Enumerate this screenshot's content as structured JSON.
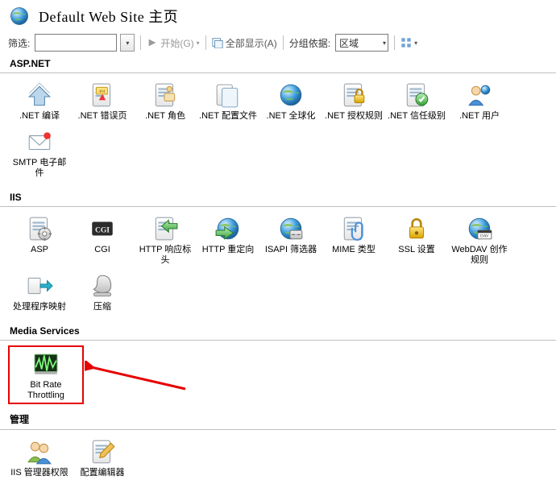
{
  "header": {
    "title": "Default Web Site 主页"
  },
  "toolbar": {
    "filter_label": "筛选:",
    "filter_value": "",
    "start_label": "开始(G)",
    "show_all_label": "全部显示(A)",
    "group_by_label": "分组依据:",
    "group_by_value": "区域"
  },
  "sections": {
    "aspnet": {
      "title": "ASP.NET",
      "items": [
        {
          "label": ".NET 编译",
          "icon": "compile"
        },
        {
          "label": ".NET 错误页",
          "icon": "errorpage"
        },
        {
          "label": ".NET 角色",
          "icon": "roles"
        },
        {
          "label": ".NET 配置文件",
          "icon": "profile"
        },
        {
          "label": ".NET 全球化",
          "icon": "globalization"
        },
        {
          "label": ".NET 授权规则",
          "icon": "authrules"
        },
        {
          "label": ".NET 信任级别",
          "icon": "trust"
        },
        {
          "label": ".NET 用户",
          "icon": "users"
        },
        {
          "label": "SMTP 电子邮件",
          "icon": "smtp"
        }
      ]
    },
    "iis": {
      "title": "IIS",
      "items": [
        {
          "label": "ASP",
          "icon": "asp"
        },
        {
          "label": "CGI",
          "icon": "cgi"
        },
        {
          "label": "HTTP 响应标头",
          "icon": "httpheaders"
        },
        {
          "label": "HTTP 重定向",
          "icon": "redirect"
        },
        {
          "label": "ISAPI 筛选器",
          "icon": "isapi"
        },
        {
          "label": "MIME 类型",
          "icon": "mime"
        },
        {
          "label": "SSL 设置",
          "icon": "ssl"
        },
        {
          "label": "WebDAV 创作规则",
          "icon": "webdav"
        },
        {
          "label": "处理程序映射",
          "icon": "handlers"
        },
        {
          "label": "压缩",
          "icon": "compression"
        }
      ]
    },
    "media": {
      "title": "Media Services",
      "items": [
        {
          "label": "Bit Rate Throttling",
          "icon": "bitrate"
        }
      ]
    },
    "manage": {
      "title": "管理",
      "items": [
        {
          "label": "IIS 管理器权限",
          "icon": "iismgrperm"
        },
        {
          "label": "配置编辑器",
          "icon": "configeditor"
        }
      ]
    }
  }
}
